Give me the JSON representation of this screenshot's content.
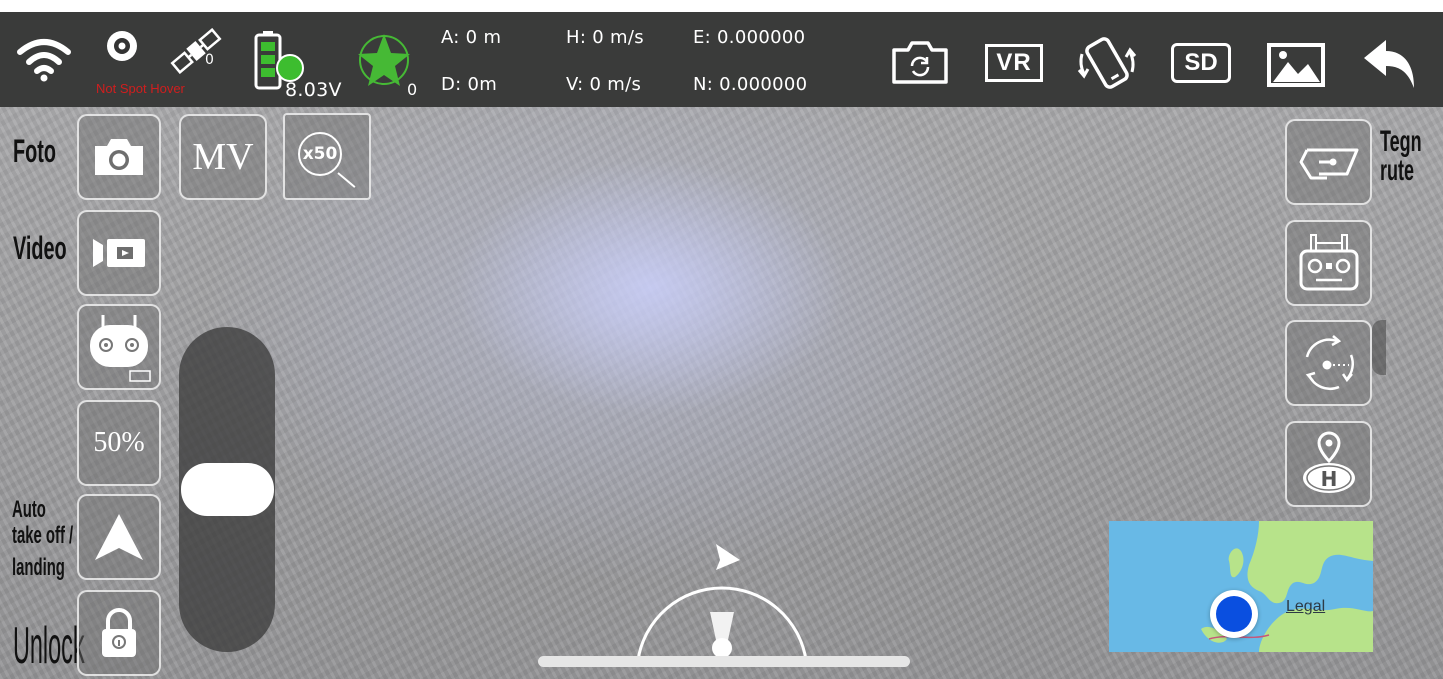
{
  "status": {
    "hover_mode": "Not Spot Hover",
    "gps_satellites": "0",
    "battery_voltage": "8.03V",
    "signal_count": "0"
  },
  "telemetry": {
    "altitude": "A: 0 m",
    "distance": "D: 0m",
    "h_speed": "H: 0 m/s",
    "v_speed": "V: 0 m/s",
    "east": "E: 0.000000",
    "north": "N: 0.000000"
  },
  "toolbar": {
    "vr_label": "VR",
    "sd_label": "SD"
  },
  "left_panel": {
    "foto_label": "Foto",
    "video_label": "Video",
    "mv_label": "MV",
    "zoom_label": "x50",
    "speed_label": "50%",
    "auto_label_1": "Auto",
    "auto_label_2": "take off /",
    "auto_label_3": "landing",
    "unlock_label": "Unlock"
  },
  "right_panel": {
    "route_label_1": "Tegn",
    "route_label_2": "rute"
  },
  "map": {
    "legal_label": "Legal"
  },
  "colors": {
    "topbar": "#3a3b3a",
    "battery_green": "#3dbd2f",
    "signal_green": "#46b935",
    "warning_red": "#d01e1e",
    "location_blue": "#0a4fe0"
  }
}
